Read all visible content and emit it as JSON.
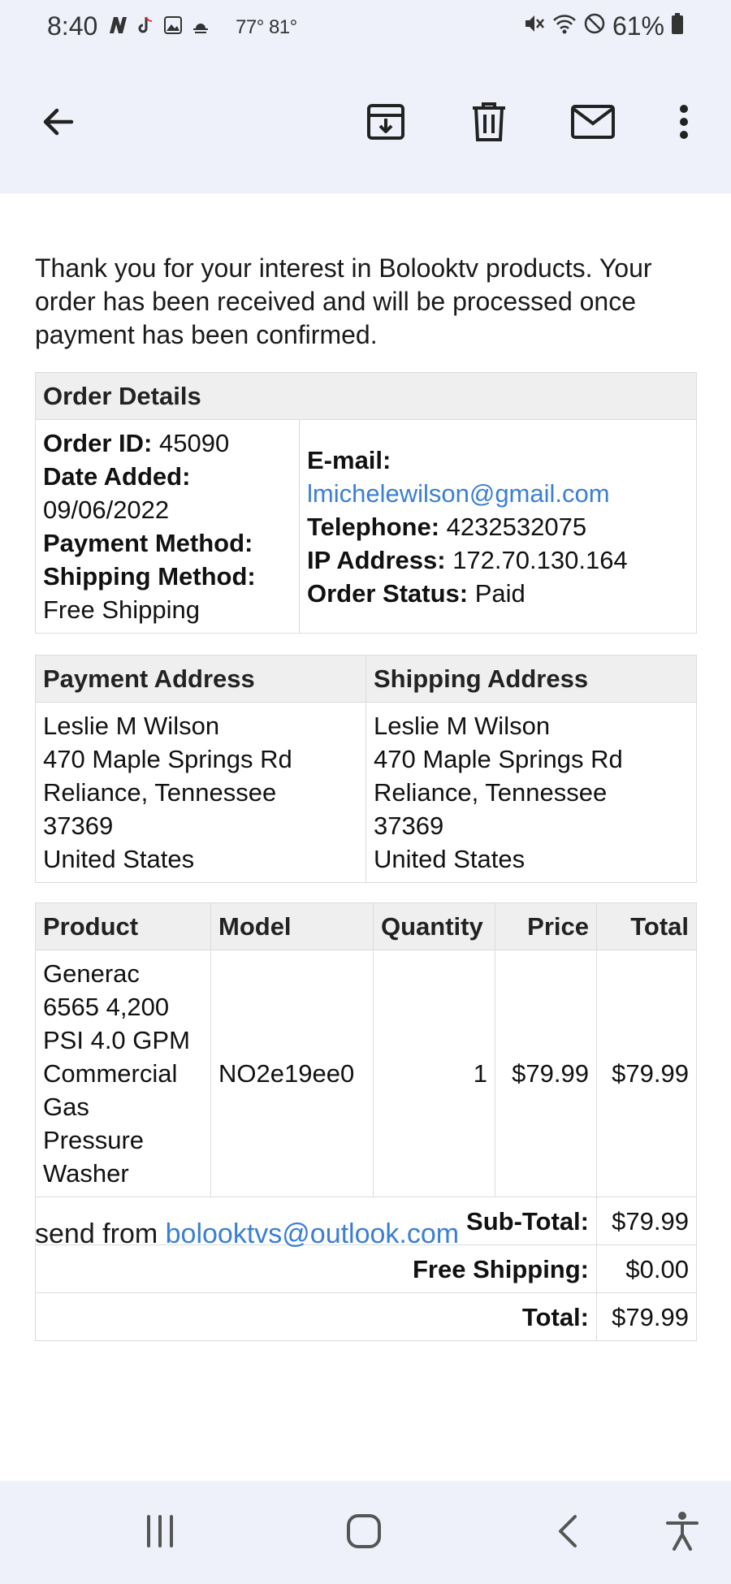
{
  "status_bar": {
    "time": "8:40",
    "temperature": "77° 81°",
    "battery": "61%",
    "left_icons": [
      "n-app-icon",
      "tiktok-icon",
      "gallery-icon",
      "weather-icon"
    ],
    "right_icons": [
      "mute-icon",
      "wifi-icon",
      "dnd-icon",
      "battery-icon"
    ]
  },
  "app_bar": {
    "icons": [
      "back-arrow-icon",
      "archive-icon",
      "delete-icon",
      "mark-unread-icon",
      "more-vert-icon"
    ]
  },
  "email": {
    "intro": "Thank you for your interest in Bolooktv products. Your order has been received and will be processed once payment has been confirmed.",
    "order_details": {
      "header": "Order Details",
      "order_id_label": "Order ID:",
      "order_id": "45090",
      "date_added_label": "Date Added:",
      "date_added": "09/06/2022",
      "payment_method_label": "Payment Method:",
      "shipping_method_label": "Shipping Method:",
      "shipping_method": "Free Shipping",
      "email_label": "E-mail:",
      "email": "lmichelewilson@gmail.com",
      "telephone_label": "Telephone:",
      "telephone": "4232532075",
      "ip_label": "IP Address:",
      "ip": "172.70.130.164",
      "status_label": "Order Status:",
      "status": "Paid"
    },
    "addresses": {
      "payment_header": "Payment Address",
      "shipping_header": "Shipping Address",
      "payment": [
        "Leslie M Wilson",
        "470 Maple Springs Rd",
        "Reliance, Tennessee",
        "37369",
        "United States"
      ],
      "shipping": [
        "Leslie M Wilson",
        "470 Maple Springs Rd",
        "Reliance, Tennessee",
        "37369",
        "United States"
      ]
    },
    "products": {
      "columns": [
        "Product",
        "Model",
        "Quantity",
        "Price",
        "Total"
      ],
      "rows": [
        {
          "product_lines": [
            "Generac",
            "6565 4,200",
            "PSI 4.0 GPM",
            "Commercial",
            "Gas",
            "Pressure",
            "Washer"
          ],
          "model": "NO2e19ee0",
          "quantity": "1",
          "price": "$79.99",
          "total": "$79.99"
        }
      ],
      "summary": [
        {
          "label": "Sub-Total:",
          "value": "$79.99"
        },
        {
          "label": "Free Shipping:",
          "value": "$0.00"
        },
        {
          "label": "Total:",
          "value": "$79.99"
        }
      ]
    },
    "send_from_label": "send from",
    "send_from_email": "bolooktvs@outlook.com"
  },
  "nav_bar": {
    "icons": [
      "recent-apps-icon",
      "home-icon",
      "back-icon",
      "accessibility-icon"
    ]
  }
}
